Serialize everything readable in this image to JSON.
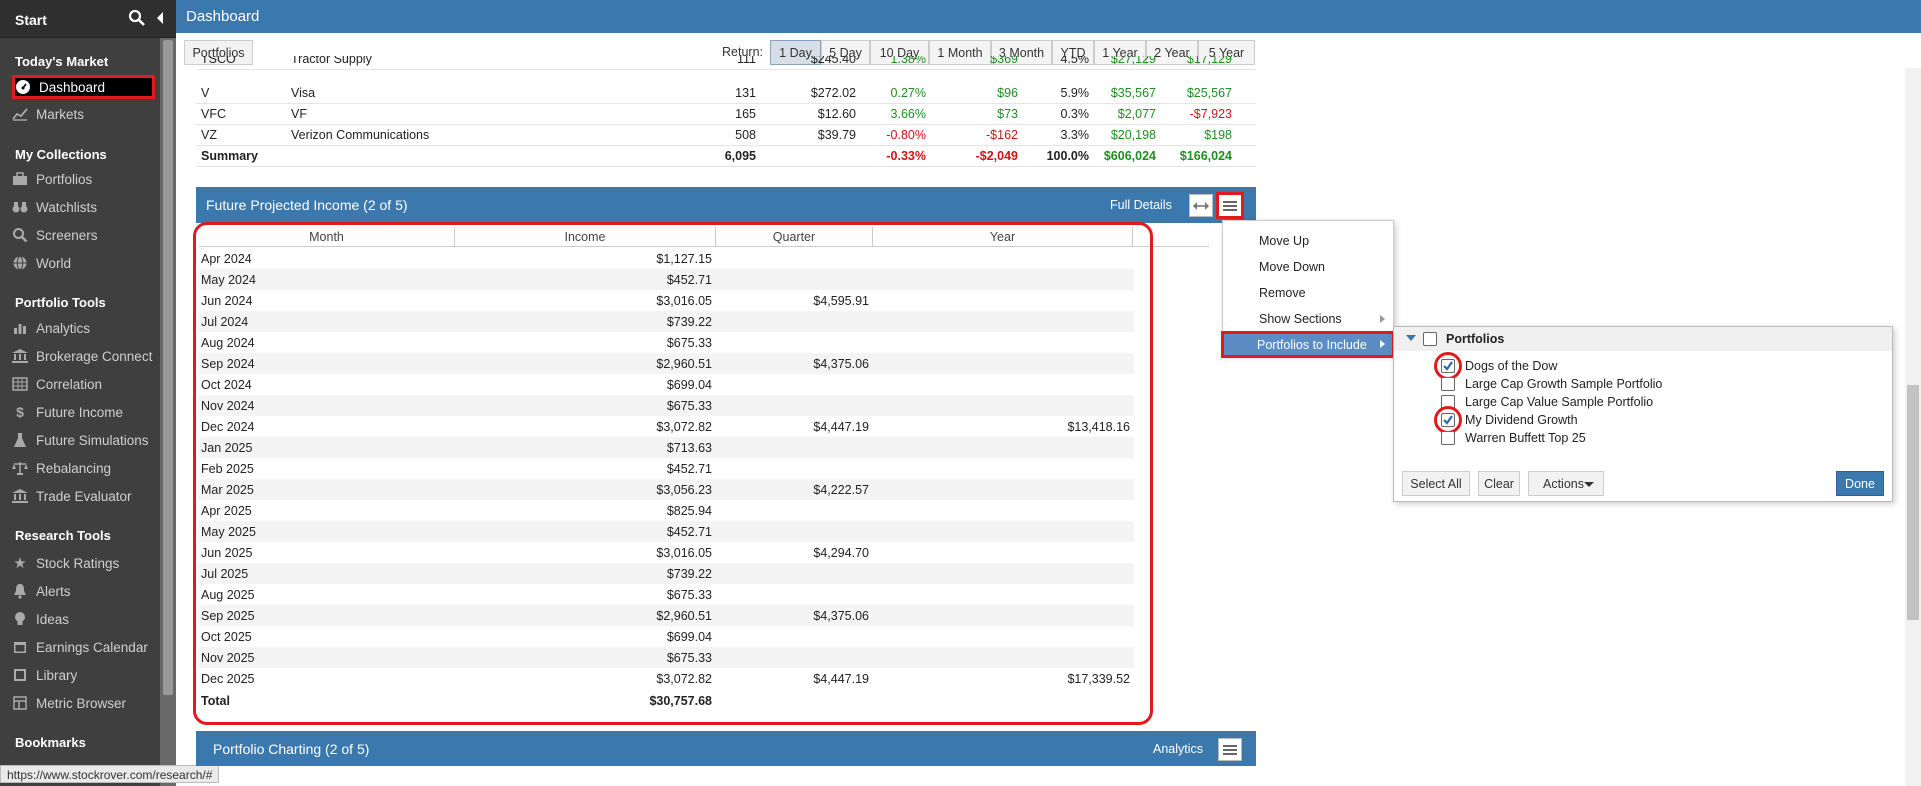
{
  "sidebar": {
    "start_label": "Start",
    "sections": [
      {
        "title": "Today's Market",
        "items": [
          {
            "label": "Dashboard",
            "icon": "gauge-icon",
            "active": true
          },
          {
            "label": "Markets",
            "icon": "chart-icon"
          }
        ]
      },
      {
        "title": "My Collections",
        "items": [
          {
            "label": "Portfolios",
            "icon": "briefcase-icon"
          },
          {
            "label": "Watchlists",
            "icon": "binoculars-icon"
          },
          {
            "label": "Screeners",
            "icon": "search-icon"
          },
          {
            "label": "World",
            "icon": "globe-icon"
          }
        ]
      },
      {
        "title": "Portfolio Tools",
        "items": [
          {
            "label": "Analytics",
            "icon": "bar-chart-icon"
          },
          {
            "label": "Brokerage Connect",
            "icon": "bank-icon"
          },
          {
            "label": "Correlation",
            "icon": "grid-icon"
          },
          {
            "label": "Future Income",
            "icon": "dollar-icon"
          },
          {
            "label": "Future Simulations",
            "icon": "flask-icon"
          },
          {
            "label": "Rebalancing",
            "icon": "scale-icon"
          },
          {
            "label": "Trade Evaluator",
            "icon": "bank-icon"
          }
        ]
      },
      {
        "title": "Research Tools",
        "items": [
          {
            "label": "Stock Ratings",
            "icon": "star-icon"
          },
          {
            "label": "Alerts",
            "icon": "bell-icon"
          },
          {
            "label": "Ideas",
            "icon": "bulb-icon"
          },
          {
            "label": "Earnings Calendar",
            "icon": "calendar-icon"
          },
          {
            "label": "Library",
            "icon": "book-icon"
          },
          {
            "label": "Metric Browser",
            "icon": "table-icon"
          }
        ]
      },
      {
        "title": "Bookmarks",
        "items": []
      }
    ]
  },
  "status_url": "https://www.stockrover.com/research/#",
  "topbar": {
    "title": "Dashboard"
  },
  "toolbar": {
    "portfolios_label": "Portfolios",
    "return_label": "Return:",
    "return_buttons": [
      "1 Day",
      "5 Day",
      "10 Day",
      "1 Month",
      "3 Month",
      "YTD",
      "1 Year",
      "2 Year",
      "5 Year"
    ],
    "active_return": "1 Day"
  },
  "stock_rows": [
    {
      "ticker": "TSCO",
      "name": "Tractor Supply",
      "shares": "111",
      "price": "$245.40",
      "ret_pct": "1.38%",
      "ret_usd": "$369",
      "weight": "4.5%",
      "value": "$27,129",
      "gain": "$17,129"
    },
    {
      "ticker": "V",
      "name": "Visa",
      "shares": "131",
      "price": "$272.02",
      "ret_pct": "0.27%",
      "ret_usd": "$96",
      "weight": "5.9%",
      "value": "$35,567",
      "gain": "$25,567"
    },
    {
      "ticker": "VFC",
      "name": "VF",
      "shares": "165",
      "price": "$12.60",
      "ret_pct": "3.66%",
      "ret_usd": "$73",
      "weight": "0.3%",
      "value": "$2,077",
      "gain": "-$7,923"
    },
    {
      "ticker": "VZ",
      "name": "Verizon Communications",
      "shares": "508",
      "price": "$39.79",
      "ret_pct": "-0.80%",
      "ret_usd": "-$162",
      "weight": "3.3%",
      "value": "$20,198",
      "gain": "$198"
    }
  ],
  "summary_row": {
    "label": "Summary",
    "shares": "6,095",
    "ret_pct": "-0.33%",
    "ret_usd": "-$2,049",
    "weight": "100.0%",
    "value": "$606,024",
    "gain": "$166,024"
  },
  "income_panel": {
    "title": "Future Projected Income (2 of 5)",
    "full_details": "Full Details",
    "columns": [
      "Month",
      "Income",
      "Quarter",
      "Year"
    ],
    "rows": [
      {
        "month": "Apr 2024",
        "income": "$1,127.15",
        "quarter": "",
        "year": ""
      },
      {
        "month": "May 2024",
        "income": "$452.71",
        "quarter": "",
        "year": ""
      },
      {
        "month": "Jun 2024",
        "income": "$3,016.05",
        "quarter": "$4,595.91",
        "year": ""
      },
      {
        "month": "Jul 2024",
        "income": "$739.22",
        "quarter": "",
        "year": ""
      },
      {
        "month": "Aug 2024",
        "income": "$675.33",
        "quarter": "",
        "year": ""
      },
      {
        "month": "Sep 2024",
        "income": "$2,960.51",
        "quarter": "$4,375.06",
        "year": ""
      },
      {
        "month": "Oct 2024",
        "income": "$699.04",
        "quarter": "",
        "year": ""
      },
      {
        "month": "Nov 2024",
        "income": "$675.33",
        "quarter": "",
        "year": ""
      },
      {
        "month": "Dec 2024",
        "income": "$3,072.82",
        "quarter": "$4,447.19",
        "year": "$13,418.16"
      },
      {
        "month": "Jan 2025",
        "income": "$713.63",
        "quarter": "",
        "year": ""
      },
      {
        "month": "Feb 2025",
        "income": "$452.71",
        "quarter": "",
        "year": ""
      },
      {
        "month": "Mar 2025",
        "income": "$3,056.23",
        "quarter": "$4,222.57",
        "year": ""
      },
      {
        "month": "Apr 2025",
        "income": "$825.94",
        "quarter": "",
        "year": ""
      },
      {
        "month": "May 2025",
        "income": "$452.71",
        "quarter": "",
        "year": ""
      },
      {
        "month": "Jun 2025",
        "income": "$3,016.05",
        "quarter": "$4,294.70",
        "year": ""
      },
      {
        "month": "Jul 2025",
        "income": "$739.22",
        "quarter": "",
        "year": ""
      },
      {
        "month": "Aug 2025",
        "income": "$675.33",
        "quarter": "",
        "year": ""
      },
      {
        "month": "Sep 2025",
        "income": "$2,960.51",
        "quarter": "$4,375.06",
        "year": ""
      },
      {
        "month": "Oct 2025",
        "income": "$699.04",
        "quarter": "",
        "year": ""
      },
      {
        "month": "Nov 2025",
        "income": "$675.33",
        "quarter": "",
        "year": ""
      },
      {
        "month": "Dec 2025",
        "income": "$3,072.82",
        "quarter": "$4,447.19",
        "year": "$17,339.52"
      }
    ],
    "total_label": "Total",
    "total_income": "$30,757.68"
  },
  "charting_panel": {
    "title": "Portfolio Charting (2 of 5)",
    "analytics_label": "Analytics"
  },
  "context_menu": {
    "items": [
      "Move Up",
      "Move Down",
      "Remove",
      "Show Sections",
      "Portfolios to Include"
    ]
  },
  "portfolio_popup": {
    "header": "Portfolios",
    "items": [
      {
        "label": "Dogs of the Dow",
        "checked": true
      },
      {
        "label": "Large Cap Growth Sample Portfolio",
        "checked": false
      },
      {
        "label": "Large Cap Value Sample Portfolio",
        "checked": false
      },
      {
        "label": "My Dividend Growth",
        "checked": true
      },
      {
        "label": "Warren Buffett Top 25",
        "checked": false
      }
    ],
    "select_all": "Select All",
    "clear": "Clear",
    "actions": "Actions",
    "done": "Done"
  },
  "colors": {
    "accent": "#3a78ad",
    "highlight_red": "#e01b1b",
    "positive": "#1f8f1f",
    "negative": "#d01414"
  }
}
